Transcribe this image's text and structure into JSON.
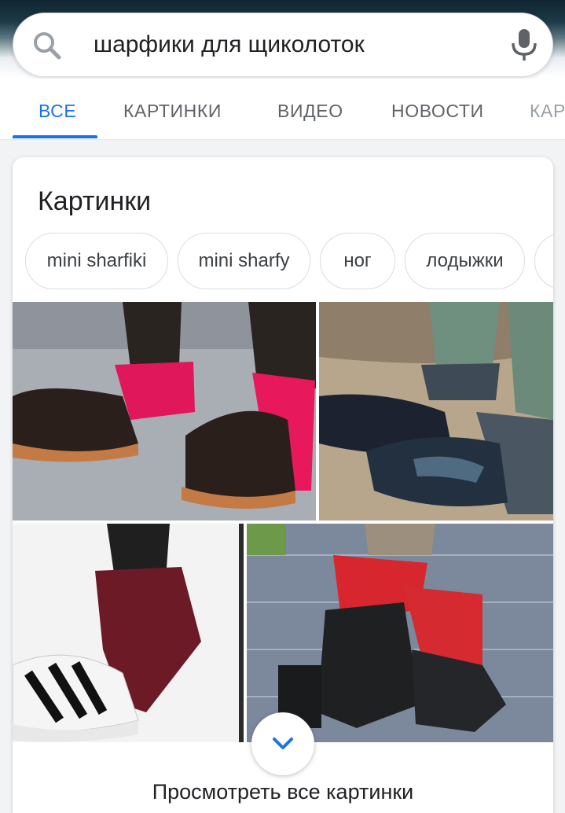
{
  "search": {
    "query": "шарфики для щиколоток",
    "search_icon": "search-icon",
    "mic_icon": "microphone-icon"
  },
  "tabs": [
    {
      "label": "ВСЕ",
      "active": true
    },
    {
      "label": "КАРТИНКИ",
      "active": false
    },
    {
      "label": "ВИДЕО",
      "active": false
    },
    {
      "label": "НОВОСТИ",
      "active": false
    },
    {
      "label": "КАРТЫ",
      "active": false
    }
  ],
  "images_card": {
    "title": "Картинки",
    "chips": [
      "mini sharfiki",
      "mini sharfy",
      "ног",
      "лодыжки",
      ""
    ],
    "expand_icon": "chevron-down-icon",
    "see_all_label": "Просмотреть все картинки"
  },
  "colors": {
    "accent": "#1a73e8",
    "text": "#202124",
    "muted": "#5f6368"
  }
}
